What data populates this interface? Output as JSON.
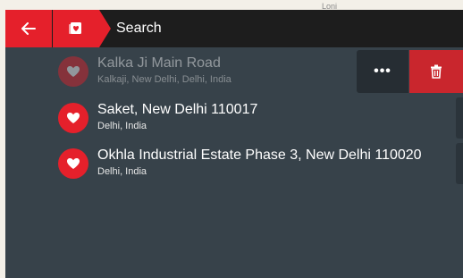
{
  "map": {
    "label": "Loni"
  },
  "topbar": {
    "title": "Search",
    "back_icon": "arrow-left-icon",
    "favorites_icon": "favorites-icon"
  },
  "favorites": [
    {
      "title": "Kalka Ji Main Road",
      "subtitle": "Kalkaji, New Delhi, Delhi, India",
      "state": "swiped"
    },
    {
      "title": "Saket, New Delhi 110017",
      "subtitle": "Delhi, India"
    },
    {
      "title": "Okhla Industrial Estate Phase 3, New Delhi 110020",
      "subtitle": "Delhi, India"
    }
  ],
  "row_actions": {
    "more_label": "•••",
    "delete_icon": "trash-icon"
  },
  "colors": {
    "accent": "#e5202b",
    "panel": "#37424a",
    "topbar": "#1d1d1d",
    "delete": "#c9262d"
  }
}
